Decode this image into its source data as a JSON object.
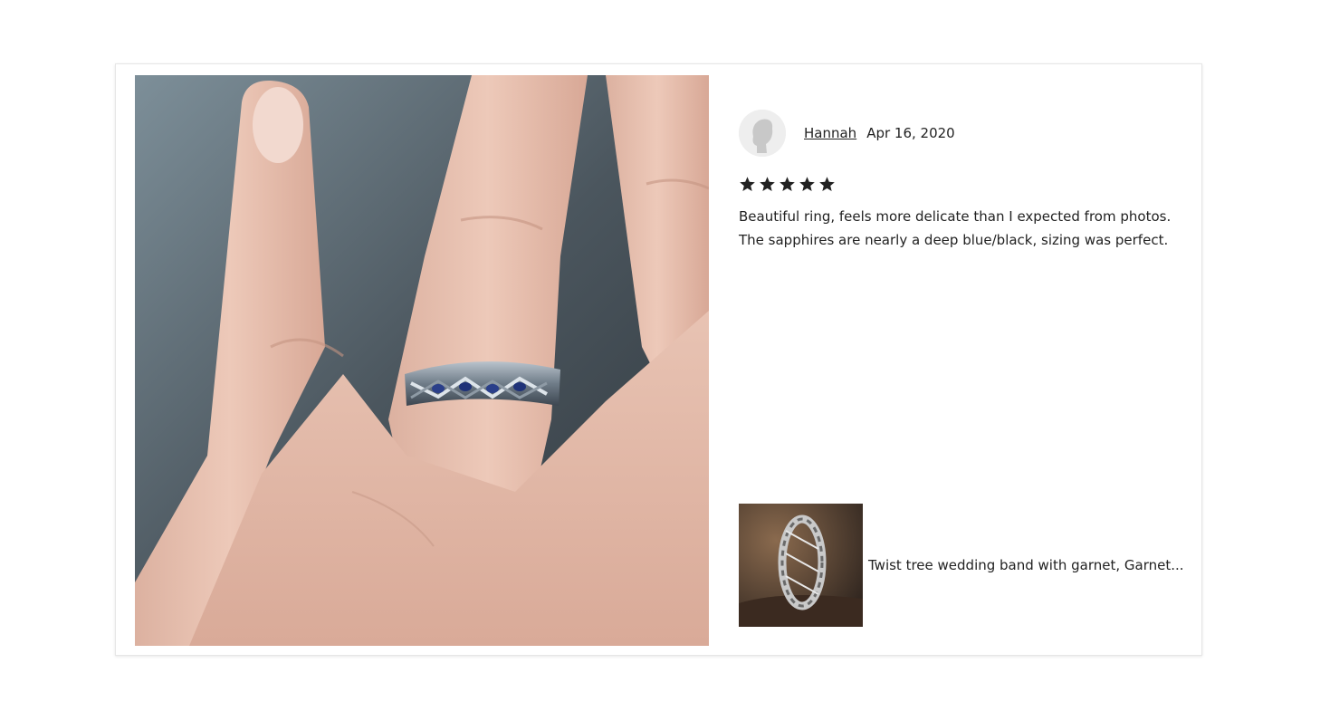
{
  "review": {
    "reviewer_name": "Hannah",
    "date": "Apr 16, 2020",
    "rating": 5,
    "rating_max": 5,
    "text_line1": "Beautiful ring, feels more delicate than I expected from photos.",
    "text_line2": "The sapphires are nearly a deep blue/black, sizing was perfect."
  },
  "item": {
    "title": "Twist tree wedding band with garnet, Garnet..."
  },
  "icons": {
    "avatar": "user-silhouette-icon",
    "star": "star-filled-icon"
  },
  "colors": {
    "text": "#222222",
    "star": "#222222",
    "card_border": "#e6e6e6"
  }
}
